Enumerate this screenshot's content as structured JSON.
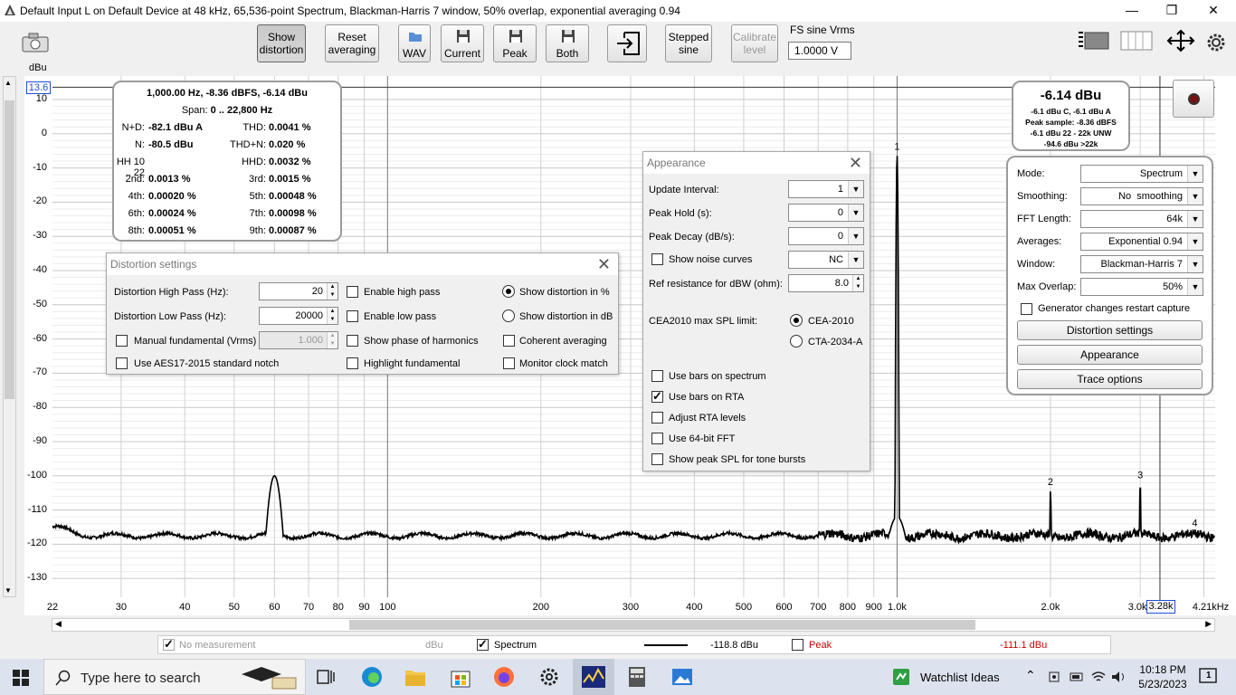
{
  "window": {
    "title": "Default Input L on Default Device at 48 kHz, 65,536-point Spectrum, Blackman-Harris 7 window, 50% overlap, exponential averaging 0.94",
    "minimize": "—",
    "restore": "❐",
    "close": "✕"
  },
  "toolbar": {
    "show_distortion": [
      "Show",
      "distortion"
    ],
    "reset_averaging": [
      "Reset",
      "averaging"
    ],
    "wav": "WAV",
    "current": "Current",
    "peak": "Peak",
    "both": "Both",
    "stepped_sine": [
      "Stepped",
      "sine"
    ],
    "calibrate_level": [
      "Calibrate",
      "level"
    ],
    "fs_sine_label": "FS sine Vrms",
    "fs_sine_value": "1.0000 V"
  },
  "plot": {
    "y_unit": "dBu",
    "y_top_value": "13.6",
    "y_ticks": [
      "10",
      "0",
      "-10",
      "-20",
      "-30",
      "-40",
      "-50",
      "-60",
      "-70",
      "-80",
      "-90",
      "-100",
      "-110",
      "-120",
      "-130"
    ],
    "x_ticks": [
      "22",
      "30",
      "40",
      "50",
      "60",
      "70",
      "80",
      "90",
      "100",
      "200",
      "300",
      "400",
      "500",
      "600",
      "700",
      "800",
      "900",
      "1.0k",
      "2.0k",
      "3.0k",
      "4.21kHz"
    ],
    "x_cursor_value": "3.28k",
    "harmonic_markers": [
      "1",
      "2",
      "3",
      "4"
    ]
  },
  "distortion_panel": {
    "header": "1,000.00 Hz, -8.36 dBFS, -6.14 dBu",
    "span_label": "Span:",
    "span_value": "0 .. 22,800 Hz",
    "rows": [
      {
        "l_label": "N+D:",
        "l_value": "-82.1 dBu A",
        "r_label": "THD:",
        "r_value": "0.0041 %"
      },
      {
        "l_label": "N:",
        "l_value": "-80.5 dBu",
        "r_label": "THD+N:",
        "r_value": "0.020 %"
      },
      {
        "l_label": "HH 10 .. 22",
        "l_value": "",
        "r_label": "HHD:",
        "r_value": "0.0032 %"
      },
      {
        "l_label": "2nd:",
        "l_value": "0.0013 %",
        "r_label": "3rd:",
        "r_value": "0.0015 %"
      },
      {
        "l_label": "4th:",
        "l_value": "0.00020 %",
        "r_label": "5th:",
        "r_value": "0.00048 %"
      },
      {
        "l_label": "6th:",
        "l_value": "0.00024 %",
        "r_label": "7th:",
        "r_value": "0.00098 %"
      },
      {
        "l_label": "8th:",
        "l_value": "0.00051 %",
        "r_label": "9th:",
        "r_value": "0.00087 %"
      }
    ]
  },
  "level_panel": {
    "big": "-6.14 dBu",
    "lines": [
      "-6.1 dBu C, -6.1 dBu A",
      "Peak sample: -8.36 dBFS",
      "-6.1 dBu 22 - 22k UNW",
      "-94.6 dBu >22k"
    ]
  },
  "distortion_settings": {
    "title": "Distortion settings",
    "high_pass_label": "Distortion High Pass (Hz):",
    "high_pass_value": "20",
    "low_pass_label": "Distortion Low Pass (Hz):",
    "low_pass_value": "20000",
    "manual_fundamental": "Manual fundamental (Vrms)",
    "manual_fundamental_value": "1.000",
    "aes17": "Use AES17-2015 standard notch",
    "enable_high_pass": "Enable high pass",
    "enable_low_pass": "Enable low pass",
    "show_phase": "Show phase of harmonics",
    "highlight_fundamental": "Highlight fundamental",
    "show_pct": "Show distortion in %",
    "show_db": "Show distortion in dB",
    "coherent": "Coherent averaging",
    "monitor_clock": "Monitor clock match"
  },
  "appearance": {
    "title": "Appearance",
    "update_interval_label": "Update Interval:",
    "update_interval_value": "1",
    "peak_hold_label": "Peak Hold (s):",
    "peak_hold_value": "0",
    "peak_decay_label": "Peak Decay (dB/s):",
    "peak_decay_value": "0",
    "noise_curves": "Show noise curves",
    "noise_curves_value": "NC",
    "ref_res_label": "Ref resistance for dBW (ohm):",
    "ref_res_value": "8.0",
    "cea_label": "CEA2010 max SPL limit:",
    "cea_2010": "CEA-2010",
    "cta_2034": "CTA-2034-A",
    "bars_spectrum": "Use bars on spectrum",
    "bars_rta": "Use bars on RTA",
    "adjust_rta": "Adjust RTA levels",
    "fft64": "Use 64-bit FFT",
    "peak_spl": "Show peak SPL for tone bursts"
  },
  "settings_panel": {
    "mode_label": "Mode:",
    "mode_value": "Spectrum",
    "smoothing_label": "Smoothing:",
    "smoothing_value": "No  smoothing",
    "fft_label": "FFT Length:",
    "fft_value": "64k",
    "averages_label": "Averages:",
    "averages_value": "Exponential 0.94",
    "window_label": "Window:",
    "window_value": "Blackman-Harris 7",
    "overlap_label": "Max Overlap:",
    "overlap_value": "50%",
    "restart_capture": "Generator changes restart capture",
    "distortion_settings_btn": "Distortion settings",
    "appearance_btn": "Appearance",
    "trace_options_btn": "Trace options"
  },
  "legend": {
    "no_measurement": "No measurement",
    "no_measurement_unit": "dBu",
    "spectrum": "Spectrum",
    "spectrum_value": "-118.8 dBu",
    "peak": "Peak",
    "peak_value": "-111.1 dBu"
  },
  "taskbar": {
    "search_placeholder": "Type here to search",
    "watchlist": "Watchlist Ideas",
    "time": "10:18 PM",
    "date": "5/23/2023",
    "notifications": "1"
  },
  "colors": {
    "trace": "#000000",
    "peak": "#cc0000",
    "accent": "#0078d7"
  }
}
